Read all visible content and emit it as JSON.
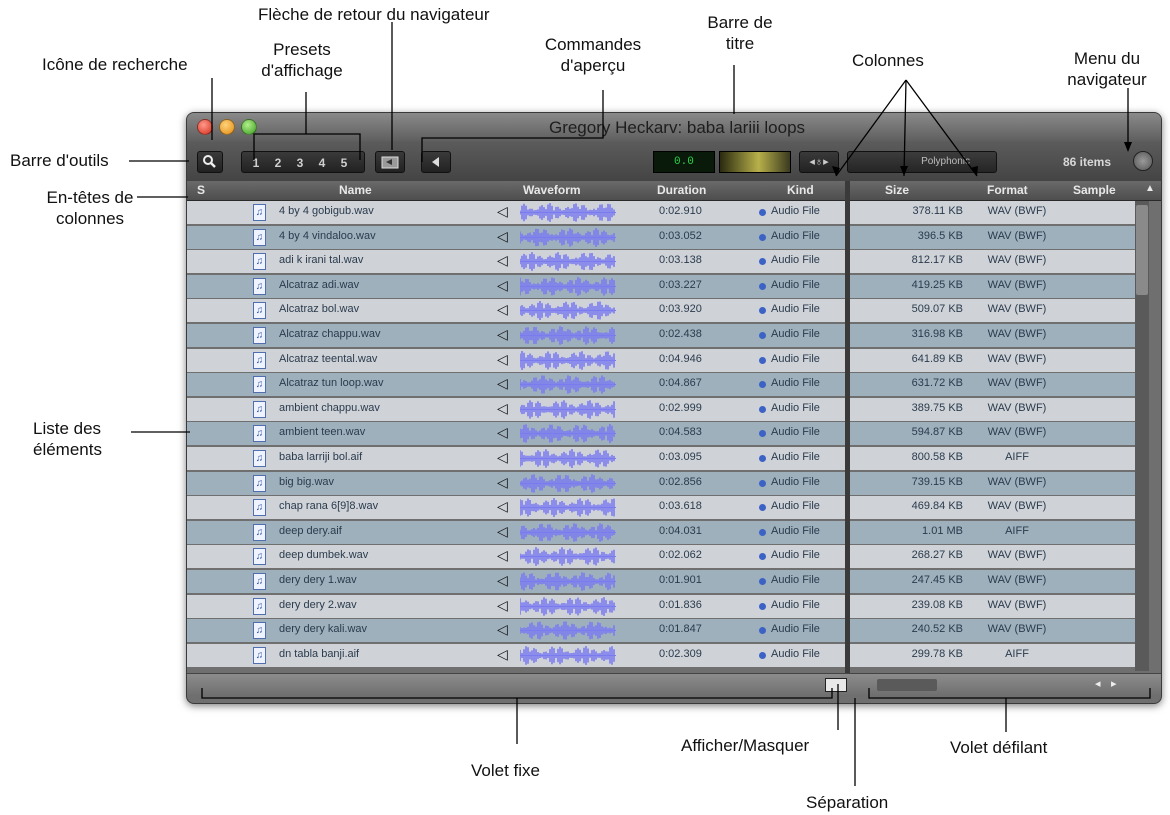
{
  "annotations": {
    "fleche_retour": "Flèche de retour du navigateur",
    "barre_titre": "Barre de\ntitre",
    "commandes_apercu": "Commandes\nd'aperçu",
    "presets": "Presets\nd'affichage",
    "icone_recherche": "Icône de recherche",
    "menu_navigateur": "Menu du\nnavigateur",
    "colonnes": "Colonnes",
    "barre_outils": "Barre d'outils",
    "en_tetes": "En-têtes de\ncolonnes",
    "liste": "Liste des\néléments",
    "volet_fixe": "Volet fixe",
    "afficher_masquer": "Afficher/Masquer",
    "volet_defilant": "Volet défilant",
    "separation": "Séparation"
  },
  "window": {
    "title": "Gregory Heckarv: baba lariii loops",
    "item_count": "86 items",
    "polyphonic": "Polyphonic",
    "meter_value": "0.0",
    "presets": [
      "1",
      "2",
      "3",
      "4",
      "5"
    ]
  },
  "columns": {
    "s": "S",
    "name": "Name",
    "waveform": "Waveform",
    "duration": "Duration",
    "kind": "Kind",
    "size": "Size",
    "format": "Format",
    "sample": "Sample"
  },
  "files": [
    {
      "name": "4 by 4 gobigub.wav",
      "duration": "0:02.910",
      "kind": "Audio File",
      "size": "378.11 KB",
      "format": "WAV (BWF)"
    },
    {
      "name": "4 by 4 vindaloo.wav",
      "duration": "0:03.052",
      "kind": "Audio File",
      "size": "396.5 KB",
      "format": "WAV (BWF)"
    },
    {
      "name": "adi k irani tal.wav",
      "duration": "0:03.138",
      "kind": "Audio File",
      "size": "812.17 KB",
      "format": "WAV (BWF)"
    },
    {
      "name": "Alcatraz adi.wav",
      "duration": "0:03.227",
      "kind": "Audio File",
      "size": "419.25 KB",
      "format": "WAV (BWF)"
    },
    {
      "name": "Alcatraz bol.wav",
      "duration": "0:03.920",
      "kind": "Audio File",
      "size": "509.07 KB",
      "format": "WAV (BWF)"
    },
    {
      "name": "Alcatraz chappu.wav",
      "duration": "0:02.438",
      "kind": "Audio File",
      "size": "316.98 KB",
      "format": "WAV (BWF)"
    },
    {
      "name": "Alcatraz teental.wav",
      "duration": "0:04.946",
      "kind": "Audio File",
      "size": "641.89 KB",
      "format": "WAV (BWF)"
    },
    {
      "name": "Alcatraz tun loop.wav",
      "duration": "0:04.867",
      "kind": "Audio File",
      "size": "631.72 KB",
      "format": "WAV (BWF)"
    },
    {
      "name": "ambient chappu.wav",
      "duration": "0:02.999",
      "kind": "Audio File",
      "size": "389.75 KB",
      "format": "WAV (BWF)"
    },
    {
      "name": "ambient teen.wav",
      "duration": "0:04.583",
      "kind": "Audio File",
      "size": "594.87 KB",
      "format": "WAV (BWF)"
    },
    {
      "name": "baba larriji bol.aif",
      "duration": "0:03.095",
      "kind": "Audio File",
      "size": "800.58 KB",
      "format": "AIFF"
    },
    {
      "name": "big big.wav",
      "duration": "0:02.856",
      "kind": "Audio File",
      "size": "739.15 KB",
      "format": "WAV (BWF)"
    },
    {
      "name": "chap rana 6[9]8.wav",
      "duration": "0:03.618",
      "kind": "Audio File",
      "size": "469.84 KB",
      "format": "WAV (BWF)"
    },
    {
      "name": "deep dery.aif",
      "duration": "0:04.031",
      "kind": "Audio File",
      "size": "1.01 MB",
      "format": "AIFF"
    },
    {
      "name": "deep dumbek.wav",
      "duration": "0:02.062",
      "kind": "Audio File",
      "size": "268.27 KB",
      "format": "WAV (BWF)"
    },
    {
      "name": "dery dery 1.wav",
      "duration": "0:01.901",
      "kind": "Audio File",
      "size": "247.45 KB",
      "format": "WAV (BWF)"
    },
    {
      "name": "dery dery 2.wav",
      "duration": "0:01.836",
      "kind": "Audio File",
      "size": "239.08 KB",
      "format": "WAV (BWF)"
    },
    {
      "name": "dery dery kali.wav",
      "duration": "0:01.847",
      "kind": "Audio File",
      "size": "240.52 KB",
      "format": "WAV (BWF)"
    },
    {
      "name": "dn tabla banji.aif",
      "duration": "0:02.309",
      "kind": "Audio File",
      "size": "299.78 KB",
      "format": "AIFF"
    }
  ],
  "colors": {
    "waveform": "#7b7bf0",
    "row_light": "#cfd3d8",
    "row_dark": "#9fb0bd"
  },
  "icons": [
    "search-icon",
    "back-arrow-icon",
    "speaker-icon",
    "file-icon",
    "browser-menu-icon"
  ]
}
